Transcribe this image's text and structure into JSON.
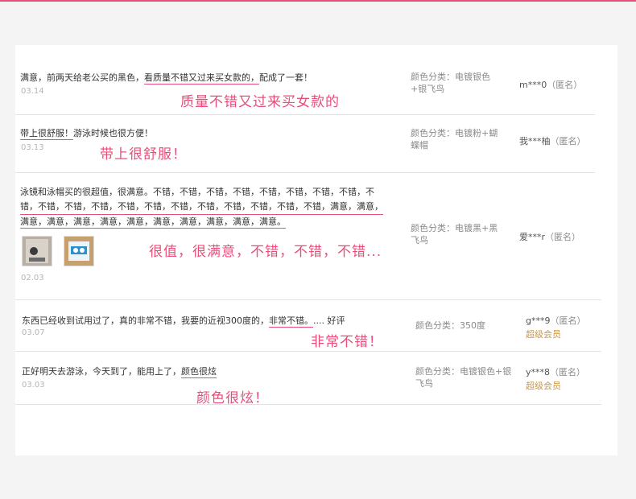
{
  "colors": {
    "accent": "#e94d7a",
    "vip": "#c8974a",
    "date": "#b5b5b5"
  },
  "reviews": [
    {
      "text_pre": "满意，前两天给老公买的黑色，",
      "text_u": "看质量不错又过来买女款的，",
      "text_post": "配成了一套！",
      "date": "03.14",
      "highlight": "质量不错又过来买女款的",
      "spec": "颜色分类：电镀银色+银飞鸟",
      "user": "m***0",
      "anon": "（匿名）",
      "vip": ""
    },
    {
      "text_pre": "",
      "text_u": "带上很舒服！",
      "text_post": "游泳时候也很方便！",
      "date": "03.13",
      "highlight": "带上很舒服！",
      "spec": "颜色分类：电镀粉+蝴蝶帽",
      "user": "我***柚",
      "anon": "（匿名）",
      "vip": ""
    },
    {
      "line1": "泳镜和泳帽买的很超值，很满意。不错，不错，不错，不错，不错，不错，不错，不错，不",
      "line2": "错，不错，不错，不错，不错，不错，不错，不错，不错，不错，不错，不错，满意，满意，",
      "line3": "满意，满意，满意，满意，满意，满意，满意，满意，满意，满意。",
      "date": "02.03",
      "highlight": "很值，很满意，不错，不错，不错...",
      "spec": "颜色分类：电镀黑+黑飞鸟",
      "user": "爱***r",
      "anon": "（匿名）",
      "vip": "",
      "thumbs": [
        "goggle-photo",
        "goggle-package-photo"
      ]
    },
    {
      "text_pre": "东西已经收到试用过了，真的非常不错，我要的近视300度的，",
      "text_u": "非常不错。",
      "text_post": ".... 好评",
      "date": "03.07",
      "highlight": "非常不错！",
      "spec": "颜色分类：350度",
      "user": "g***9",
      "anon": "（匿名）",
      "vip": "超级会员"
    },
    {
      "text_pre": "正好明天去游泳，今天到了，能用上了，",
      "text_u": "颜色很炫",
      "text_post": "",
      "date": "03.03",
      "highlight": "颜色很炫！",
      "spec": "颜色分类：电镀银色+银飞鸟",
      "user": "y***8",
      "anon": "（匿名）",
      "vip": "超级会员"
    }
  ]
}
